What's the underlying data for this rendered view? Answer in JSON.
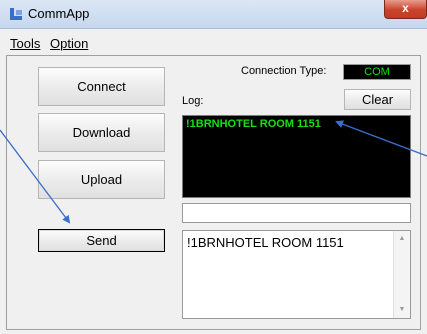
{
  "window": {
    "title": "CommApp",
    "close_glyph": "x"
  },
  "menu": [
    {
      "mnemonic": "T",
      "rest": "ools"
    },
    {
      "mnemonic": "O",
      "rest": "ption"
    }
  ],
  "buttons": {
    "connect": "Connect",
    "download": "Download",
    "upload": "Upload",
    "send": "Send",
    "clear": "Clear"
  },
  "connection": {
    "label": "Connection Type:",
    "value": "COM"
  },
  "log": {
    "label": "Log:",
    "text": "!1BRNHOTEL ROOM 1151"
  },
  "send_input": {
    "value": ""
  },
  "message_area": {
    "text": "!1BRNHOTEL ROOM 1151"
  },
  "icons": {
    "app": "app-icon",
    "close": "close-icon",
    "scroll_up": "scroll-up-icon",
    "scroll_down": "scroll-down-icon"
  },
  "colors": {
    "log_background": "#000000",
    "log_text": "#16e016",
    "annotation_arrow": "#3a6fc9"
  }
}
